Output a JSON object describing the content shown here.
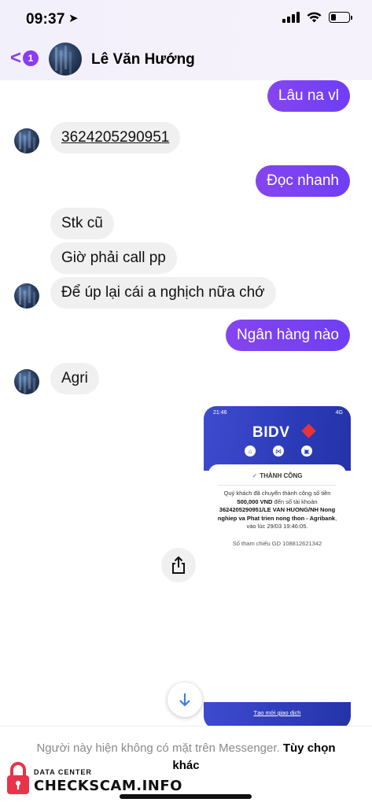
{
  "status_bar": {
    "time": "09:37",
    "location_glyph": "➤",
    "icons": [
      "cellular-signal-icon",
      "wifi-icon",
      "battery-icon"
    ]
  },
  "header": {
    "back_glyph": "<",
    "unread_count": "1",
    "contact_name": "Lê Văn Hướng"
  },
  "messages": [
    {
      "direction": "outgoing",
      "text": "Lâu na vl"
    },
    {
      "direction": "incoming",
      "text": "3624205290951"
    },
    {
      "direction": "outgoing",
      "text": "Đọc nhanh"
    },
    {
      "direction": "incoming",
      "text": "Stk cũ"
    },
    {
      "direction": "incoming",
      "text": "Giờ phải call pp"
    },
    {
      "direction": "incoming",
      "text": "Để úp lại cái a nghịch nữa chớ"
    },
    {
      "direction": "outgoing",
      "text": "Ngân hàng nào"
    },
    {
      "direction": "incoming",
      "text": "Agri"
    }
  ],
  "shared_image": {
    "time": "21:46",
    "network": "4G",
    "bank_logo": "BIDV",
    "status": "THÀNH CÔNG",
    "line1": "Quý khách đã chuyển thành công số tiền",
    "amount": "500,000 VND",
    "line2": "đến số tài khoản",
    "account": "3624205290951/LE VAN HUONG/NH Nong nghiep va Phat trien nong thon - Agribank",
    "line3": ", vào lúc 29/03 19:46:05.",
    "reference": "Số tham chiếu GD 108812621342",
    "new_transaction": "Tạo mới giao dịch"
  },
  "footer": {
    "note": "Người này hiện không có mặt trên Messenger.",
    "action": "Tùy chọn khác"
  },
  "watermark": {
    "small": "DATA CENTER",
    "big": "CHECKSCAM.INFO"
  },
  "colors": {
    "outgoing_bubble": "#7b3ff2",
    "incoming_bubble": "#f0f0f0",
    "accent": "#8b3cf0",
    "bidv_blue": "#2b3bb8",
    "bidv_red": "#e5343a"
  }
}
